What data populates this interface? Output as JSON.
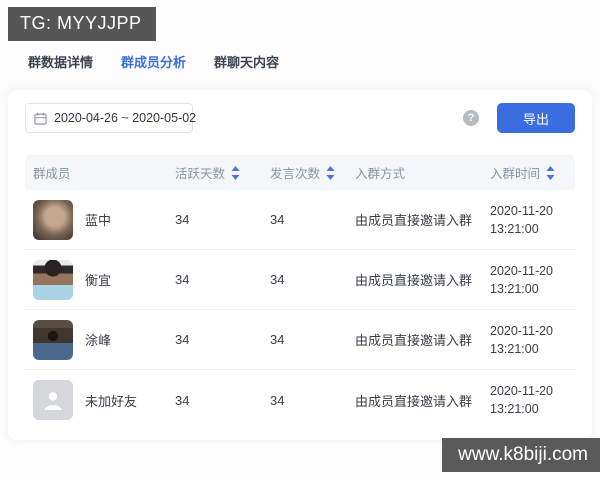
{
  "badge": {
    "text": "TG: MYYJJPP"
  },
  "tabs": [
    {
      "label": "群数据详情",
      "active": false
    },
    {
      "label": "群成员分析",
      "active": true
    },
    {
      "label": "群聊天内容",
      "active": false
    }
  ],
  "toolbar": {
    "date_range": "2020-04-26 ~ 2020-05-02",
    "help_label": "?",
    "export_label": "导出"
  },
  "table": {
    "columns": [
      {
        "label": "群成员",
        "sortable": false
      },
      {
        "label": "活跃天数",
        "sortable": true
      },
      {
        "label": "发言次数",
        "sortable": true
      },
      {
        "label": "入群方式",
        "sortable": false
      },
      {
        "label": "入群时间",
        "sortable": true
      }
    ],
    "rows": [
      {
        "name": "蓝中",
        "avatar": "photo-portrait",
        "active_days": "34",
        "messages": "34",
        "join_method": "由成员直接邀请入群",
        "join_date": "2020-11-20",
        "join_time": "13:21:00"
      },
      {
        "name": "衡宜",
        "avatar": "photo-man-cap",
        "active_days": "34",
        "messages": "34",
        "join_method": "由成员直接邀请入群",
        "join_date": "2020-11-20",
        "join_time": "13:21:00"
      },
      {
        "name": "涂峰",
        "avatar": "photo-sunglasses",
        "active_days": "34",
        "messages": "34",
        "join_method": "由成员直接邀请入群",
        "join_date": "2020-11-20",
        "join_time": "13:21:00"
      },
      {
        "name": "未加好友",
        "avatar": "placeholder-person",
        "active_days": "34",
        "messages": "34",
        "join_method": "由成员直接邀请入群",
        "join_date": "2020-11-20",
        "join_time": "13:21:00"
      }
    ]
  },
  "watermark": {
    "text": "www.k8biji.com"
  },
  "colors": {
    "accent": "#3b6fe0",
    "export_button": "#3a6ee0",
    "badge_bg": "#565656",
    "table_header_bg": "#f5f6f8",
    "header_text": "#8a94a6",
    "body_text": "#3a4049"
  }
}
